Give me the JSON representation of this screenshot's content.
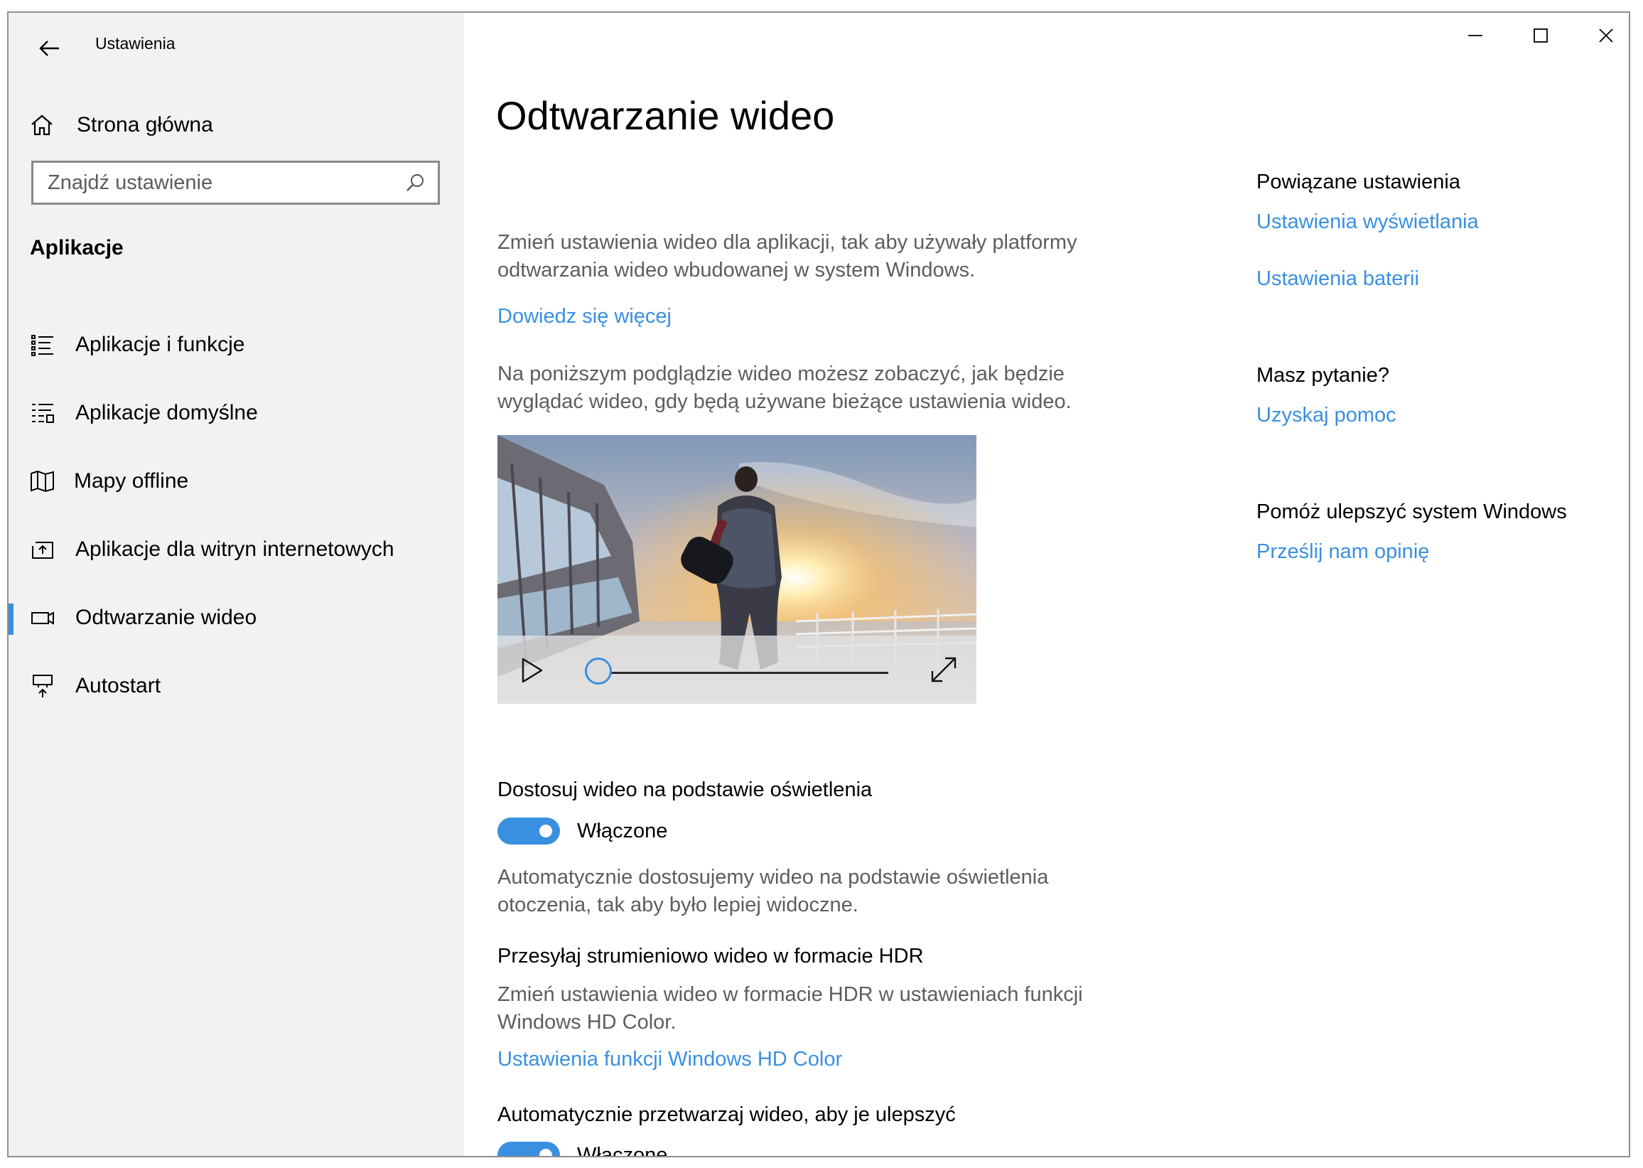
{
  "window": {
    "app_title": "Ustawienia"
  },
  "sidebar": {
    "home_label": "Strona główna",
    "search_placeholder": "Znajdź ustawienie",
    "section_title": "Aplikacje",
    "items": [
      {
        "label": "Aplikacje i funkcje",
        "icon": "apps-features-icon",
        "selected": false
      },
      {
        "label": "Aplikacje domyślne",
        "icon": "default-apps-icon",
        "selected": false
      },
      {
        "label": "Mapy offline",
        "icon": "offline-maps-icon",
        "selected": false
      },
      {
        "label": "Aplikacje dla witryn internetowych",
        "icon": "apps-for-websites-icon",
        "selected": false
      },
      {
        "label": "Odtwarzanie wideo",
        "icon": "video-playback-icon",
        "selected": true
      },
      {
        "label": "Autostart",
        "icon": "startup-icon",
        "selected": false
      }
    ]
  },
  "main": {
    "title": "Odtwarzanie wideo",
    "intro": "Zmień ustawienia wideo dla aplikacji, tak aby używały platformy odtwarzania wideo wbudowanej w system Windows.",
    "learn_more": "Dowiedz się więcej",
    "preview_desc": "Na poniższym podglądzie wideo możesz zobaczyć, jak będzie wyglądać wideo, gdy będą używane bieżące ustawienia wideo.",
    "video": {
      "progress": 0
    },
    "lighting": {
      "heading": "Dostosuj wideo na podstawie oświetlenia",
      "state": "Włączone",
      "on": true,
      "desc": "Automatycznie dostosujemy wideo na podstawie oświetlenia otoczenia, tak aby było lepiej widoczne."
    },
    "hdr": {
      "heading": "Przesyłaj strumieniowo wideo w formacie HDR",
      "desc": "Zmień ustawienia wideo w formacie HDR w ustawieniach funkcji Windows HD Color.",
      "link": "Ustawienia funkcji Windows HD Color"
    },
    "enhance": {
      "heading": "Automatycznie przetwarzaj wideo, aby je ulepszyć",
      "state": "Włączone",
      "on": true
    }
  },
  "related": {
    "heading": "Powiązane ustawienia",
    "links": [
      "Ustawienia wyświetlania",
      "Ustawienia baterii"
    ]
  },
  "question": {
    "heading": "Masz pytanie?",
    "link": "Uzyskaj pomoc"
  },
  "feedback": {
    "heading": "Pomóż ulepszyć system Windows",
    "link": "Prześlij nam opinię"
  },
  "colors": {
    "accent": "#3a90e0",
    "sidebar_bg": "#f2f2f2",
    "secondary_text": "#5d5d5d"
  }
}
